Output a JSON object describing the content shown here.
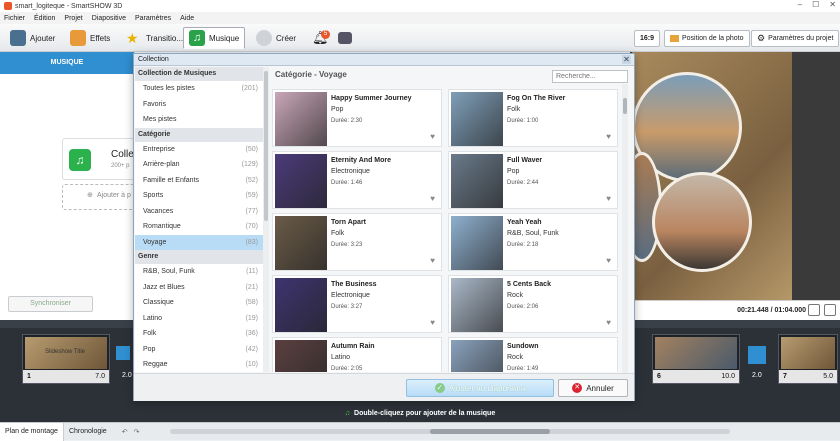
{
  "window": {
    "title": "smart_logiteque - SmartSHOW 3D"
  },
  "menu": [
    "Fichier",
    "Édition",
    "Projet",
    "Diapositive",
    "Paramètres",
    "Aide"
  ],
  "toolbar": {
    "add": "Ajouter",
    "effects": "Effets",
    "transitions": "Transitio...",
    "music": "Musique",
    "create": "Créer",
    "notif_count": "5",
    "ratio": "16:9",
    "photo_position": "Position de la photo",
    "project_settings": "Paramètres du projet"
  },
  "left_panel": {
    "tab": "MUSIQUE",
    "collection_label": "Colle",
    "collection_sub": "200+ p",
    "add_label": "Ajouter à p",
    "sync": "Synchroniser"
  },
  "dialog": {
    "title": "Collection",
    "sections": [
      {
        "header": "Collection de Musiques",
        "items": [
          {
            "label": "Toutes les pistes",
            "count": "(201)"
          },
          {
            "label": "Favoris",
            "count": ""
          },
          {
            "label": "Mes pistes",
            "count": ""
          }
        ]
      },
      {
        "header": "Catégorie",
        "items": [
          {
            "label": "Entreprise",
            "count": "(50)"
          },
          {
            "label": "Arrière-plan",
            "count": "(129)"
          },
          {
            "label": "Famille et Enfants",
            "count": "(52)"
          },
          {
            "label": "Sports",
            "count": "(59)"
          },
          {
            "label": "Vacances",
            "count": "(77)"
          },
          {
            "label": "Romantique",
            "count": "(70)"
          },
          {
            "label": "Voyage",
            "count": "(83)"
          }
        ]
      },
      {
        "header": "Genre",
        "items": [
          {
            "label": "R&B, Soul, Funk",
            "count": "(11)"
          },
          {
            "label": "Jazz et Blues",
            "count": "(21)"
          },
          {
            "label": "Classique",
            "count": "(58)"
          },
          {
            "label": "Latino",
            "count": "(19)"
          },
          {
            "label": "Folk",
            "count": "(36)"
          },
          {
            "label": "Pop",
            "count": "(42)"
          },
          {
            "label": "Reggae",
            "count": "(10)"
          }
        ]
      }
    ],
    "selected": "Voyage",
    "category_title": "Catégorie - Voyage",
    "search_placeholder": "Recherche...",
    "tracks": [
      {
        "name": "Happy Summer Journey",
        "genre": "Pop",
        "duration": "Durée: 2:30",
        "art": "#c9a7b8"
      },
      {
        "name": "Fog On The River",
        "genre": "Folk",
        "duration": "Durée: 1:00",
        "art": "#7f9fb8"
      },
      {
        "name": "Eternity And More",
        "genre": "Electronique",
        "duration": "Durée: 1:46",
        "art": "#4b3b7a"
      },
      {
        "name": "Full Waver",
        "genre": "Pop",
        "duration": "Durée: 2:44",
        "art": "#6a7a8a"
      },
      {
        "name": "Torn Apart",
        "genre": "Folk",
        "duration": "Durée: 3:23",
        "art": "#6b5b48"
      },
      {
        "name": "Yeah Yeah",
        "genre": "R&B, Soul, Funk",
        "duration": "Durée: 2:18",
        "art": "#8fb0cf"
      },
      {
        "name": "The Business",
        "genre": "Electronique",
        "duration": "Durée: 3:27",
        "art": "#3e3570"
      },
      {
        "name": "5 Cents Back",
        "genre": "Rock",
        "duration": "Durée: 2:06",
        "art": "#aab8c8"
      },
      {
        "name": "Autumn Rain",
        "genre": "Latino",
        "duration": "Durée: 2:05",
        "art": "#5a4040"
      },
      {
        "name": "Sundown",
        "genre": "Rock",
        "duration": "Durée: 1:49",
        "art": "#8aa2bc"
      }
    ],
    "add_button": "Ajouter au diaporama",
    "cancel_button": "Annuler"
  },
  "preview": {
    "time": "00:21.448 / 01:04.000"
  },
  "timeline": {
    "slides": [
      {
        "num": "1",
        "dur": "7.0",
        "title": "Slideshow Title"
      },
      {
        "num": "6",
        "dur": "10.0",
        "title": ""
      },
      {
        "num": "7",
        "dur": "5.0",
        "title": ""
      }
    ],
    "transitions": [
      "2.0",
      "2.0",
      "2.0"
    ],
    "music_hint": "Double-cliquez pour ajouter de la musique"
  },
  "bottom": {
    "tab_storyboard": "Plan de montage",
    "tab_timeline": "Chronologie"
  }
}
